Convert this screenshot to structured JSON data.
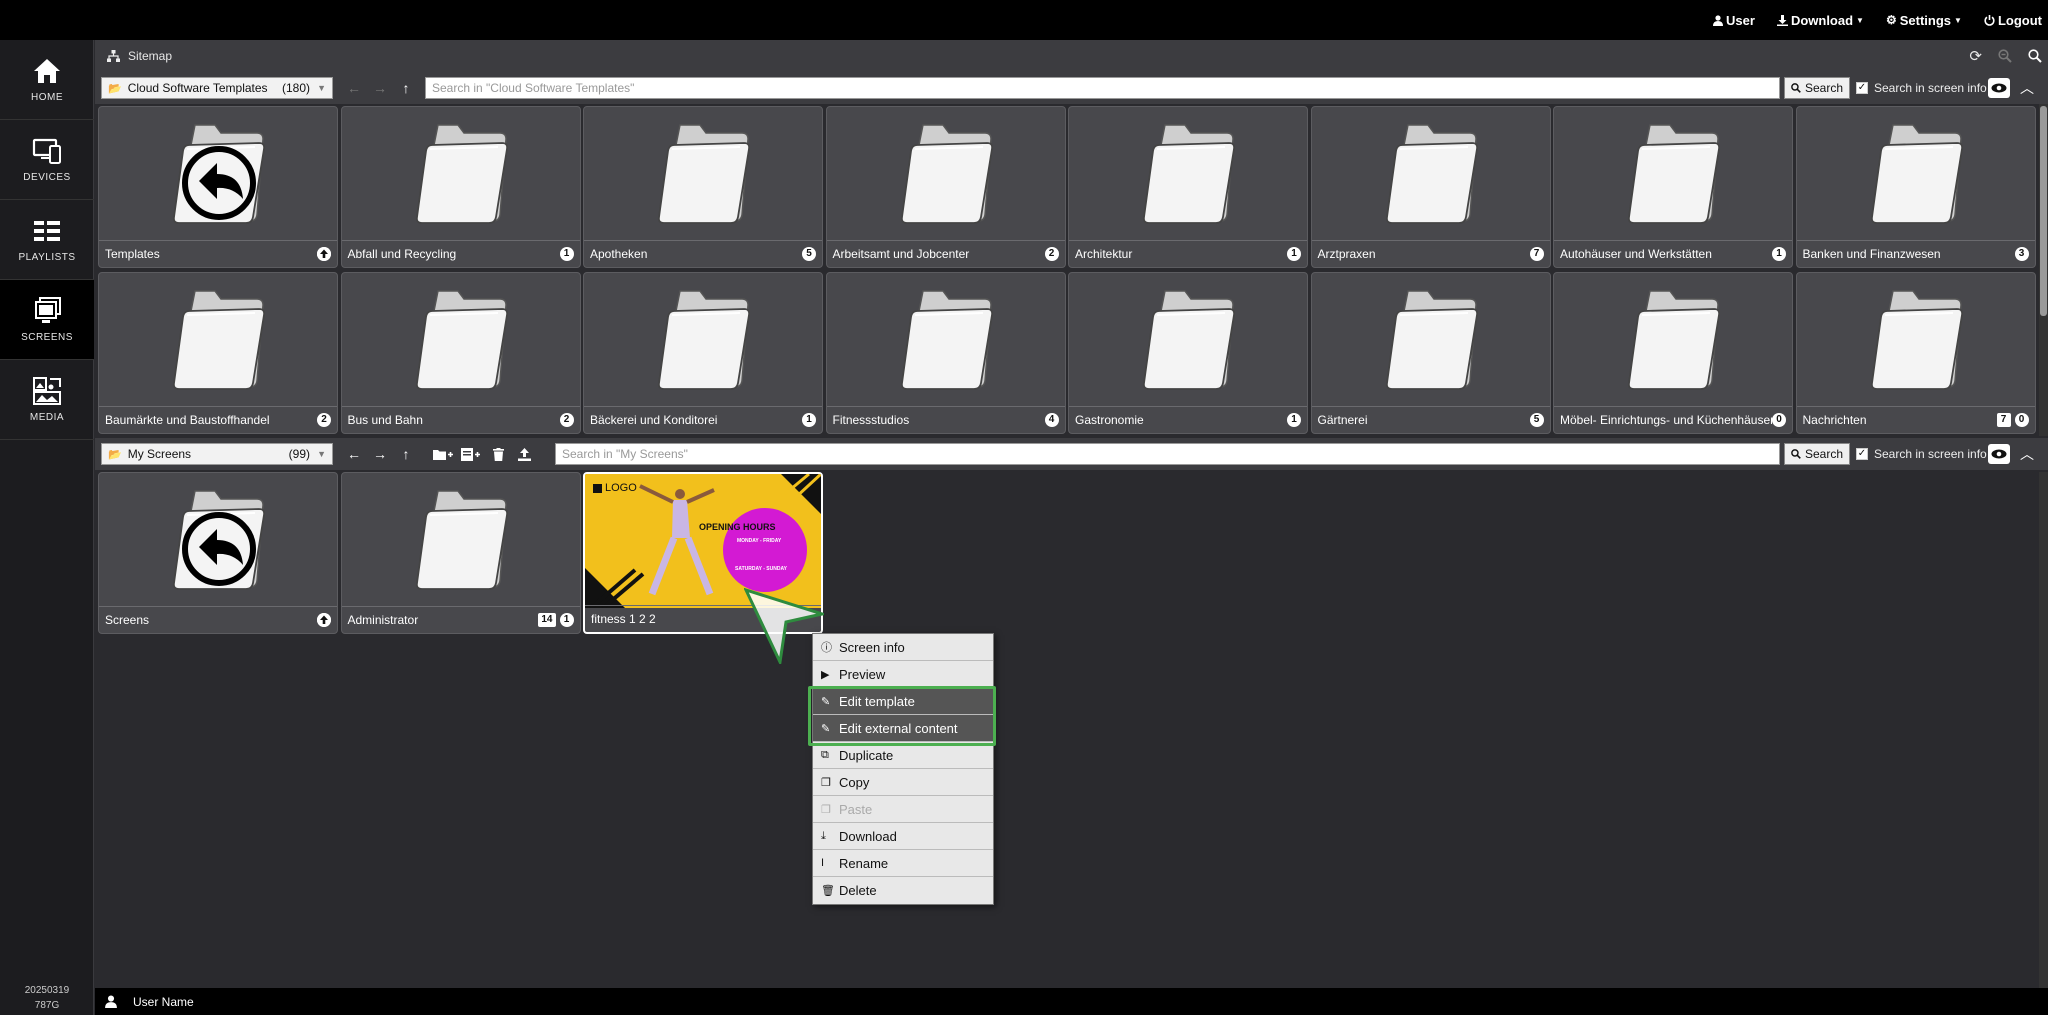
{
  "topnav": {
    "user": "User",
    "download": "Download",
    "settings": "Settings",
    "logout": "Logout"
  },
  "sidebar": {
    "items": [
      {
        "label": "HOME"
      },
      {
        "label": "DEVICES"
      },
      {
        "label": "PLAYLISTS"
      },
      {
        "label": "SCREENS"
      },
      {
        "label": "MEDIA"
      }
    ],
    "version_line1": "20250319",
    "version_line2": "787G"
  },
  "breadcrumb": {
    "label": "Sitemap"
  },
  "cloud_pane": {
    "folder_name": "Cloud Software Templates",
    "folder_count": "(180)",
    "search_placeholder": "Search in \"Cloud Software Templates\"",
    "search_label": "Search",
    "search_in_screen_info": "Search in screen info",
    "tiles": [
      {
        "name": "Templates",
        "badge": "back"
      },
      {
        "name": "Abfall und Recycling",
        "badge": "1"
      },
      {
        "name": "Apotheken",
        "badge": "5"
      },
      {
        "name": "Arbeitsamt und Jobcenter",
        "badge": "2"
      },
      {
        "name": "Architektur",
        "badge": "1"
      },
      {
        "name": "Arztpraxen",
        "badge": "7"
      },
      {
        "name": "Autohäuser und Werkstätten",
        "badge": "1"
      },
      {
        "name": "Banken und Finanzwesen",
        "badge": "3"
      },
      {
        "name": "Baumärkte und Baustoffhandel",
        "badge": "2"
      },
      {
        "name": "Bus und Bahn",
        "badge": "2"
      },
      {
        "name": "Bäckerei und Konditorei",
        "badge": "1"
      },
      {
        "name": "Fitnessstudios",
        "badge": "4"
      },
      {
        "name": "Gastronomie",
        "badge": "1"
      },
      {
        "name": "Gärtnerei",
        "badge": "5"
      },
      {
        "name": "Möbel- Einrichtungs- und Küchenhäuser",
        "badge": "0"
      },
      {
        "name": "Nachrichten",
        "badge": "0",
        "badge2": "7"
      }
    ]
  },
  "my_pane": {
    "folder_name": "My Screens",
    "folder_count": "(99)",
    "search_placeholder": "Search in \"My Screens\"",
    "search_label": "Search",
    "search_in_screen_info": "Search in screen info",
    "tiles": [
      {
        "name": "Screens",
        "badge": "back"
      },
      {
        "name": "Administrator",
        "badge": "1",
        "badge2": "14"
      },
      {
        "name": "fitness 1 2 2"
      }
    ],
    "fitness_thumb": {
      "logo": "LOGO",
      "heading": "OPENING HOURS",
      "line1": "MONDAY - FRIDAY",
      "line2": "SATURDAY - SUNDAY"
    }
  },
  "context_menu": {
    "items": [
      {
        "label": "Screen info",
        "icon": "info-icon"
      },
      {
        "label": "Preview",
        "icon": "play-icon"
      },
      {
        "label": "Edit template",
        "icon": "edit-icon"
      },
      {
        "label": "Edit external content",
        "icon": "edit-icon"
      },
      {
        "label": "Duplicate",
        "icon": "duplicate-icon"
      },
      {
        "label": "Copy",
        "icon": "copy-icon"
      },
      {
        "label": "Paste",
        "icon": "paste-icon"
      },
      {
        "label": "Download",
        "icon": "download-icon"
      },
      {
        "label": "Rename",
        "icon": "text-cursor-icon"
      },
      {
        "label": "Delete",
        "icon": "trash-icon"
      }
    ]
  },
  "bottombar": {
    "user_name": "User Name"
  },
  "colors": {
    "highlight": "#4caf50",
    "active_nav": "#000000",
    "thumb_yellow": "#f2c01c",
    "thumb_magenta": "#d31ad3"
  }
}
